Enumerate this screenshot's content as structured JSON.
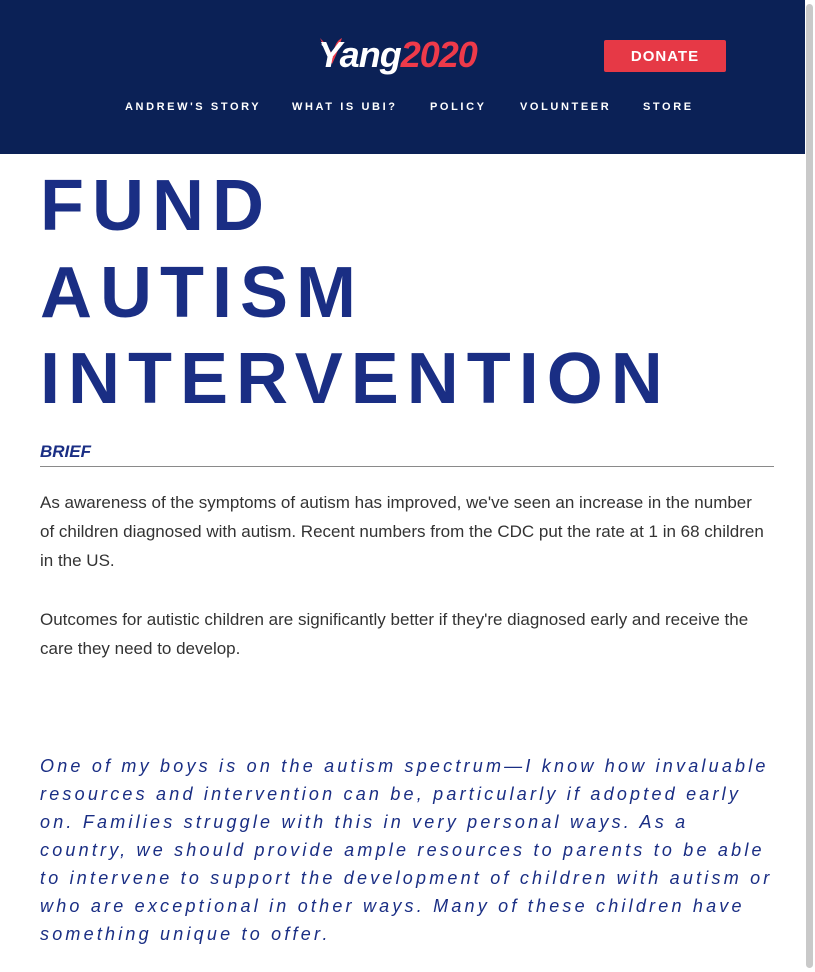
{
  "header": {
    "logo": {
      "name": "Yang",
      "year": "2020"
    },
    "donate_label": "DONATE",
    "nav": [
      {
        "label": "ANDREW'S STORY"
      },
      {
        "label": "WHAT IS UBI?"
      },
      {
        "label": "POLICY"
      },
      {
        "label": "VOLUNTEER"
      },
      {
        "label": "STORE"
      }
    ]
  },
  "main": {
    "title_lines": [
      "FUND",
      "AUTISM",
      "INTERVENTION"
    ],
    "brief_label": "BRIEF",
    "paragraphs": [
      "As awareness of the symptoms of autism has improved, we've seen an increase in the number of children diagnosed with autism. Recent numbers from the CDC put the rate at 1 in 68 children in the US.",
      "Outcomes for autistic children are significantly better if they're diagnosed early and receive the care they need to develop."
    ],
    "quote": "One of my boys is on the autism spectrum—I know how invaluable resources and intervention can be, particularly if adopted early on. Families struggle with this in very personal ways. As a country, we should provide ample resources to parents to be able to intervene to support the development of children with autism or who are exceptional in other ways. Many of these children have something unique to offer."
  },
  "colors": {
    "header_bg": "#0b2156",
    "accent_red": "#e63946",
    "title_blue": "#1a2e84",
    "body_text": "#333333"
  }
}
